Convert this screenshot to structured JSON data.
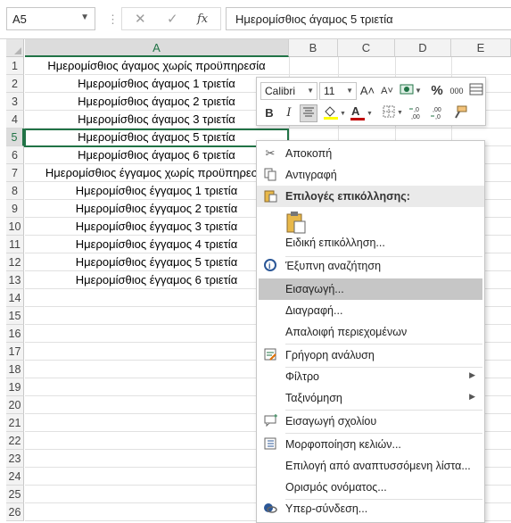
{
  "formula_bar": {
    "name_box": "A5",
    "cancel_glyph": "✕",
    "enter_glyph": "✓",
    "fx_glyph": "fx",
    "content": "Ημερομίσθιος άγαμος 5 τριετία"
  },
  "columns": [
    "A",
    "B",
    "C",
    "D",
    "E"
  ],
  "rows": [
    "1",
    "2",
    "3",
    "4",
    "5",
    "6",
    "7",
    "8",
    "9",
    "10",
    "11",
    "12",
    "13",
    "14",
    "15",
    "16",
    "17",
    "18",
    "19",
    "20",
    "21",
    "22",
    "23",
    "24",
    "25",
    "26"
  ],
  "cells_A": [
    "Ημερομίσθιος άγαμος χωρίς προϋπηρεσία",
    "Ημερομίσθιος άγαμος 1 τριετία",
    "Ημερομίσθιος άγαμος 2 τριετία",
    "Ημερομίσθιος άγαμος 3 τριετία",
    "Ημερομίσθιος άγαμος 5 τριετία",
    "Ημερομίσθιος άγαμος 6 τριετία",
    "Ημερομίσθιος έγγαμος χωρίς προϋπηρεσία",
    "Ημερομίσθιος έγγαμος 1 τριετία",
    "Ημερομίσθιος έγγαμος 2 τριετία",
    "Ημερομίσθιος έγγαμος 3 τριετία",
    "Ημερομίσθιος έγγαμος 4 τριετία",
    "Ημερομίσθιος έγγαμος 5 τριετία",
    "Ημερομίσθιος έγγαμος 6 τριετία"
  ],
  "mini_toolbar": {
    "font_name": "Calibri",
    "font_size": "11",
    "grow_font": "A˄",
    "shrink_font": "A˅",
    "percent": "%",
    "comma_style": "000",
    "bold": "B",
    "italic": "I",
    "font_color_letter": "A",
    "increase_decimal": "←,0 ,00",
    "decrease_decimal": ",00 →,0"
  },
  "context_menu": {
    "items": [
      {
        "label": "Αποκοπή",
        "icon": "scissors-icon"
      },
      {
        "label": "Αντιγραφή",
        "icon": "copy-icon"
      },
      {
        "label": "Επιλογές επικόλλησης:",
        "icon": "paste-icon"
      },
      {
        "label": "Ειδική επικόλληση...",
        "icon": ""
      },
      {
        "label": "Έξυπνη αναζήτηση",
        "icon": "smart-lookup-icon"
      },
      {
        "label": "Εισαγωγή...",
        "icon": ""
      },
      {
        "label": "Διαγραφή...",
        "icon": ""
      },
      {
        "label": "Απαλοιφή περιεχομένων",
        "icon": ""
      },
      {
        "label": "Γρήγορη ανάλυση",
        "icon": "quick-analysis-icon"
      },
      {
        "label": "Φίλτρο",
        "icon": ""
      },
      {
        "label": "Ταξινόμηση",
        "icon": ""
      },
      {
        "label": "Εισαγωγή σχολίου",
        "icon": "comment-icon"
      },
      {
        "label": "Μορφοποίηση κελιών...",
        "icon": "format-cells-icon"
      },
      {
        "label": "Επιλογή από αναπτυσσόμενη λίστα...",
        "icon": ""
      },
      {
        "label": "Ορισμός ονόματος...",
        "icon": ""
      },
      {
        "label": "Υπερ-σύνδεση...",
        "icon": "hyperlink-icon"
      }
    ]
  },
  "colors": {
    "excel_green": "#217346",
    "menu_hover": "#c6c6c6",
    "font_color_red": "#c00000",
    "highlight_yellow": "#ffff00"
  }
}
